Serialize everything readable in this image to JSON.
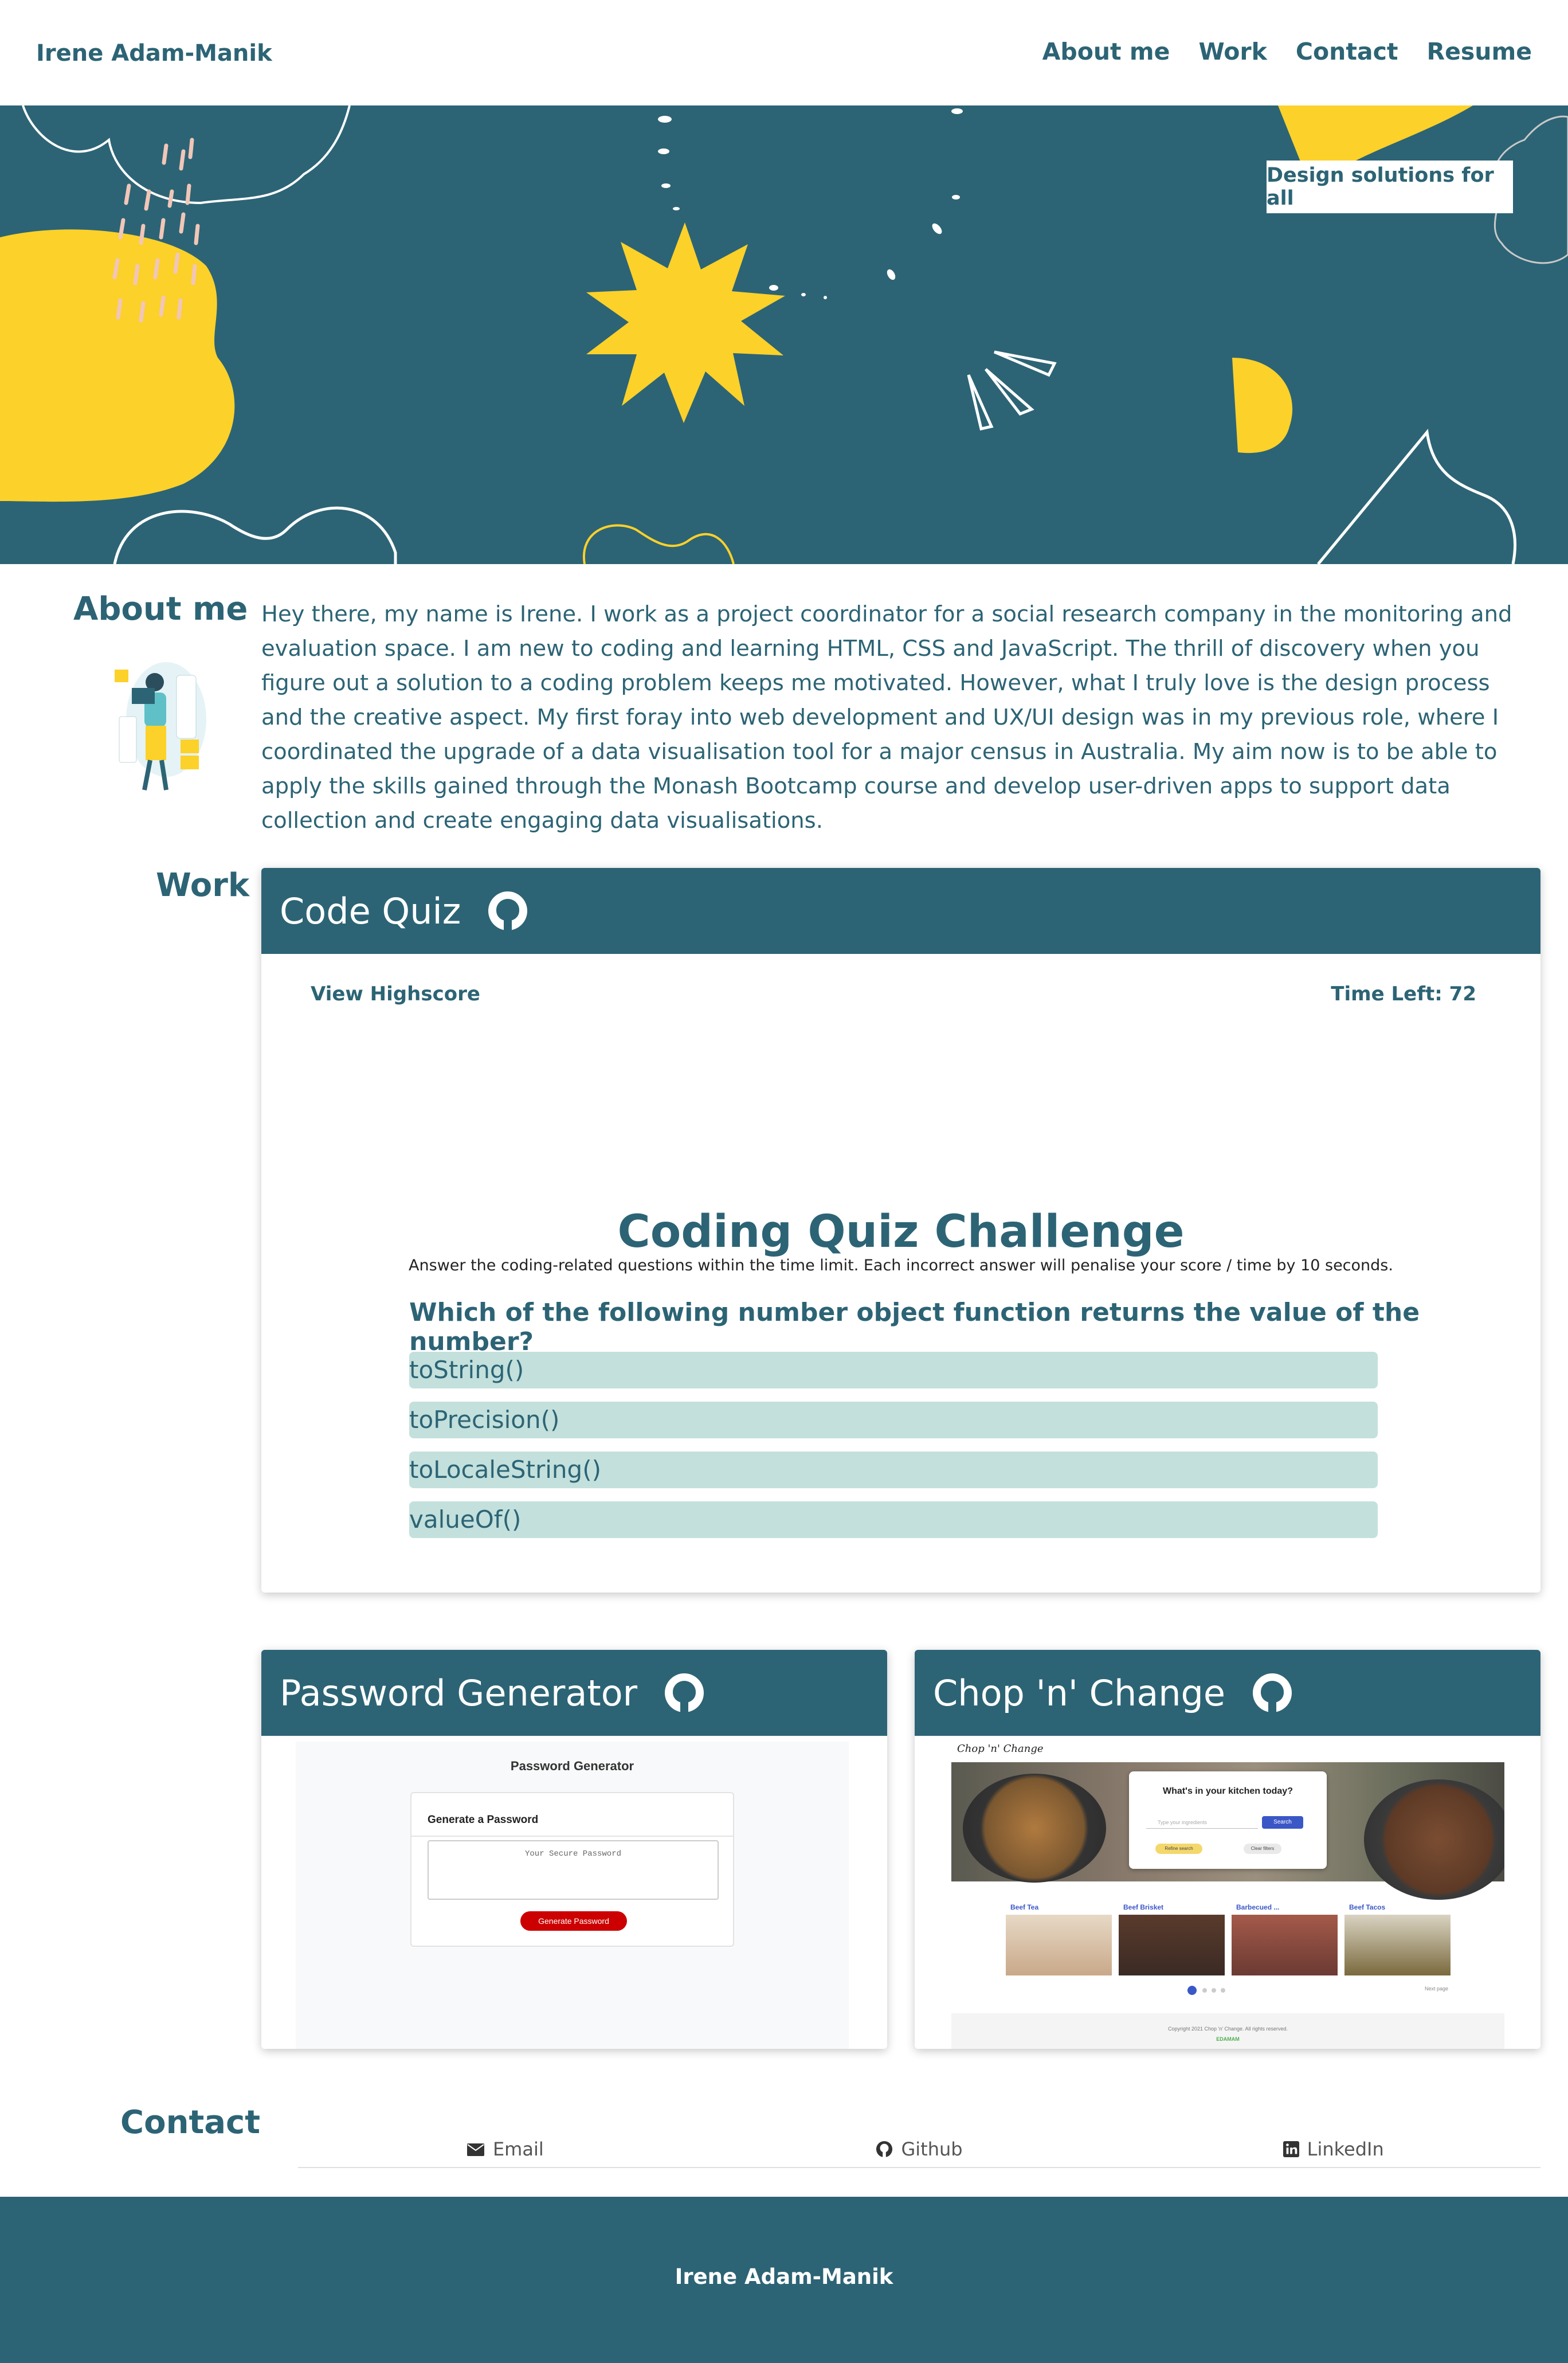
{
  "nav": {
    "brand": "Irene Adam-Manik",
    "links": [
      "About me",
      "Work",
      "Contact",
      "Resume"
    ]
  },
  "hero": {
    "badge": "Design solutions for all"
  },
  "about": {
    "title": "About me",
    "text": "Hey there, my name is Irene. I work as a project coordinator for a social research company in the monitoring and evaluation space. I am new to coding and learning HTML, CSS and JavaScript. The thrill of discovery when you figure out a solution to a coding problem keeps me motivated. However, what I truly love is the design process and the creative aspect. My first foray into web development and UX/UI design was in my previous role, where I coordinated the upgrade of a data visualisation tool for a major census in Australia. My aim now is to be able to apply the skills gained through the Monash Bootcamp course and develop user-driven apps to support data collection and create engaging data visualisations."
  },
  "work": {
    "title": "Work",
    "projects": [
      {
        "title": "Code Quiz"
      },
      {
        "title": "Password Generator"
      },
      {
        "title": "Chop 'n' Change"
      }
    ]
  },
  "quiz": {
    "view_highscore": "View Highscore",
    "time_left": "Time Left: 72",
    "heading": "Coding Quiz Challenge",
    "subtitle": "Answer the coding-related questions within the time limit. Each incorrect answer will penalise your score / time by 10 seconds.",
    "question": "Which of the following number object function returns the value of the number?",
    "options": [
      "toString()",
      "toPrecision()",
      "toLocaleString()",
      "valueOf()"
    ]
  },
  "password_generator": {
    "title": "Password Generator",
    "box_heading": "Generate a Password",
    "placeholder": "Your Secure Password",
    "button": "Generate Password"
  },
  "chop": {
    "logo": "Chop 'n' Change",
    "search_heading": "What's in your kitchen today?",
    "search_placeholder": "Type your ingredients",
    "search_button": "Search",
    "pill_1": "Refine search",
    "pill_2": "Clear filters",
    "cards": [
      "Beef Tea",
      "Beef Brisket",
      "Barbecued ...",
      "Beef Tacos"
    ],
    "next_page": "Next page",
    "footer": "Copyright 2021 Chop 'n' Change. All rights reserved.",
    "powered": "EDAMAM"
  },
  "contact": {
    "title": "Contact",
    "items": [
      "Email",
      "Github",
      "LinkedIn"
    ]
  },
  "footer": {
    "name": "Irene Adam-Manik"
  },
  "colors": {
    "primary": "#2c6475",
    "accent_yellow": "#fcd12a",
    "option_bg": "#c3e0dc"
  }
}
